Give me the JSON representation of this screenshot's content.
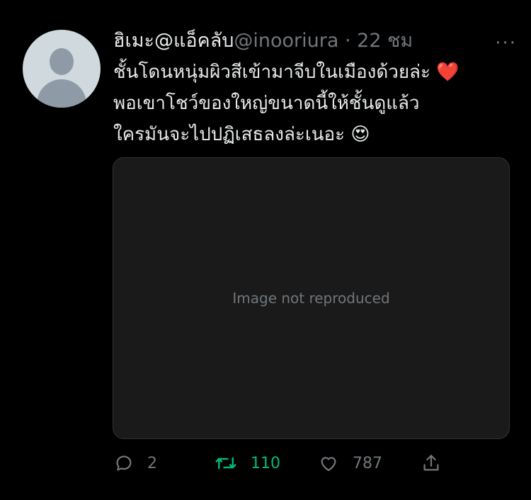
{
  "tweet": {
    "display_name": "ฮิเมะ@แอ็คลับ",
    "handle": "@inooriura",
    "separator": "·",
    "time": "22 ชม",
    "more": "···",
    "text_lines": [
      "ชั้นโดนหนุ่มผิวสีเข้ามาจีบในเมืองด้วยล่ะ ❤️",
      "พอเขาโชว์ของใหญ่ขนาดนี้ให้ชั้นดูแล้ว",
      "ใครมันจะไปปฏิเสธลงล่ะเนอะ 😍"
    ],
    "media_placeholder": "Image not reproduced"
  },
  "actions": {
    "reply_count": "2",
    "retweet_count": "110",
    "like_count": "787"
  },
  "colors": {
    "background": "#000000",
    "text": "#e7e9ea",
    "muted": "#71767b",
    "retweet_active": "#00ba7c"
  }
}
